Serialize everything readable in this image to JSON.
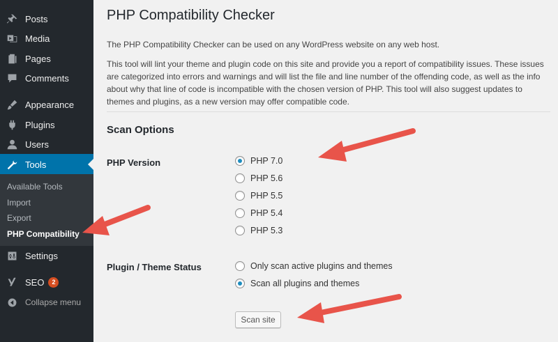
{
  "sidebar": {
    "items": [
      {
        "label": "Posts",
        "icon": "pin-icon"
      },
      {
        "label": "Media",
        "icon": "media-icon"
      },
      {
        "label": "Pages",
        "icon": "pages-icon"
      },
      {
        "label": "Comments",
        "icon": "comment-icon"
      },
      {
        "label": "Appearance",
        "icon": "brush-icon"
      },
      {
        "label": "Plugins",
        "icon": "plugin-icon"
      },
      {
        "label": "Users",
        "icon": "user-icon"
      },
      {
        "label": "Tools",
        "icon": "wrench-icon",
        "active": true
      },
      {
        "label": "Settings",
        "icon": "settings-icon"
      },
      {
        "label": "SEO",
        "icon": "seo-icon",
        "badge": "2"
      }
    ],
    "submenu": [
      "Available Tools",
      "Import",
      "Export",
      "PHP Compatibility"
    ],
    "submenu_current": "PHP Compatibility",
    "collapse_label": "Collapse menu"
  },
  "main": {
    "title": "PHP Compatibility Checker",
    "intro": "The PHP Compatibility Checker can be used on any WordPress website on any web host.",
    "description": "This tool will lint your theme and plugin code on this site and provide you a report of compatibility issues. These issues are categorized into errors and warnings and will list the file and line number of the offending code, as well as the info about why that line of code is incompatible with the chosen version of PHP. This tool will also suggest updates to themes and plugins, as a new version may offer compatible code.",
    "scan_options_heading": "Scan Options",
    "php_version_label": "PHP Version",
    "php_versions": [
      "PHP 7.0",
      "PHP 5.6",
      "PHP 5.5",
      "PHP 5.4",
      "PHP 5.3"
    ],
    "php_version_selected": "PHP 7.0",
    "status_label": "Plugin / Theme Status",
    "status_options": [
      "Only scan active plugins and themes",
      "Scan all plugins and themes"
    ],
    "status_selected": "Scan all plugins and themes",
    "scan_button": "Scan site"
  },
  "colors": {
    "sidebar_bg": "#23282d",
    "submenu_bg": "#32373c",
    "active_bg": "#0073aa",
    "page_bg": "#f1f1f1",
    "badge": "#d54e21",
    "arrow": "#e8544a"
  }
}
